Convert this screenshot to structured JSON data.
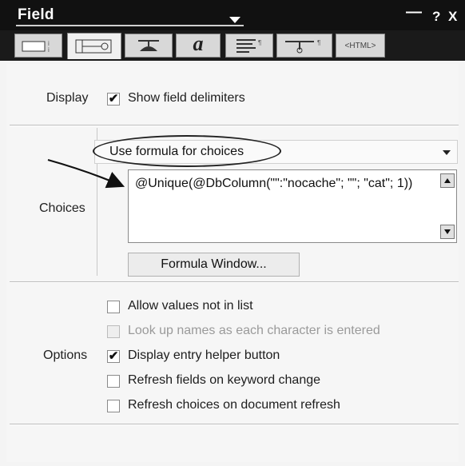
{
  "window": {
    "title": "Field",
    "pin_symbol": "—",
    "help_symbol": "?",
    "close_symbol": "X"
  },
  "tabs": [
    {
      "name": "basics",
      "icon": "field-info-icon"
    },
    {
      "name": "control",
      "icon": "control-icon",
      "active": true
    },
    {
      "name": "advanced",
      "icon": "propeller-hat-icon"
    },
    {
      "name": "font",
      "icon": "font-a-icon",
      "glyph": "a"
    },
    {
      "name": "paragraph",
      "icon": "paragraph-alignment-icon"
    },
    {
      "name": "hide-when",
      "icon": "hide-when-icon"
    },
    {
      "name": "html",
      "icon": "html-tag-icon",
      "label": "<HTML>"
    }
  ],
  "display": {
    "label": "Display",
    "show_delimiters": {
      "label": "Show field delimiters",
      "checked": true
    }
  },
  "choices": {
    "label": "Choices",
    "mode": "Use formula for choices",
    "formula": "@Unique(@DbColumn(\"\":\"nocache\"; \"\"; \"cat\"; 1))",
    "formula_button": "Formula Window..."
  },
  "options": {
    "label": "Options",
    "items": [
      {
        "label": "Allow values not in list",
        "checked": false,
        "enabled": true
      },
      {
        "label": "Look up names as each character is entered",
        "checked": false,
        "enabled": false
      },
      {
        "label": "Display entry helper button",
        "checked": true,
        "enabled": true
      },
      {
        "label": "Refresh fields on keyword change",
        "checked": false,
        "enabled": true
      },
      {
        "label": "Refresh choices on document refresh",
        "checked": false,
        "enabled": true
      }
    ]
  }
}
